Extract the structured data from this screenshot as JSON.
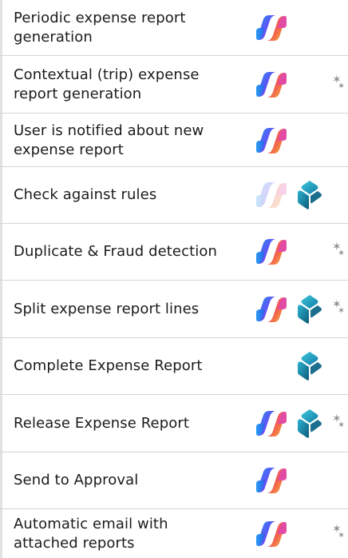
{
  "features": [
    {
      "label": "Periodic expense report\ngeneration",
      "copilot": "full",
      "bizchat": false,
      "star": false
    },
    {
      "label": "Contextual (trip) expense\nreport generation",
      "copilot": "full",
      "bizchat": false,
      "star": true
    },
    {
      "label": "User is notified about new\nexpense report",
      "copilot": "full",
      "bizchat": false,
      "star": false
    },
    {
      "label": "Check against rules",
      "copilot": "faded",
      "bizchat": true,
      "star": false
    },
    {
      "label": "Duplicate & Fraud detection",
      "copilot": "full",
      "bizchat": false,
      "star": true
    },
    {
      "label": "Split expense report lines",
      "copilot": "full",
      "bizchat": true,
      "star": true
    },
    {
      "label": "Complete Expense Report",
      "copilot": "none",
      "bizchat": true,
      "star": false
    },
    {
      "label": "Release Expense Report",
      "copilot": "full",
      "bizchat": true,
      "star": true
    },
    {
      "label": "Send to Approval",
      "copilot": "full",
      "bizchat": false,
      "star": false
    },
    {
      "label": "Automatic email with\nattached reports",
      "copilot": "full",
      "bizchat": false,
      "star": true
    }
  ],
  "icons": {
    "copilot": "copilot-icon",
    "bizchat": "copilot-studio-icon",
    "star": "sparkle-stars-icon"
  },
  "colors": {
    "copilot_gradient": [
      "#2F6FE4",
      "#8C4BFF",
      "#E6488C",
      "#F3A33A"
    ],
    "bizchat_gradient": [
      "#11495F",
      "#1C8EB8",
      "#34C3D7"
    ],
    "star": "#8e8e8e",
    "divider": "#d4d4d4"
  }
}
